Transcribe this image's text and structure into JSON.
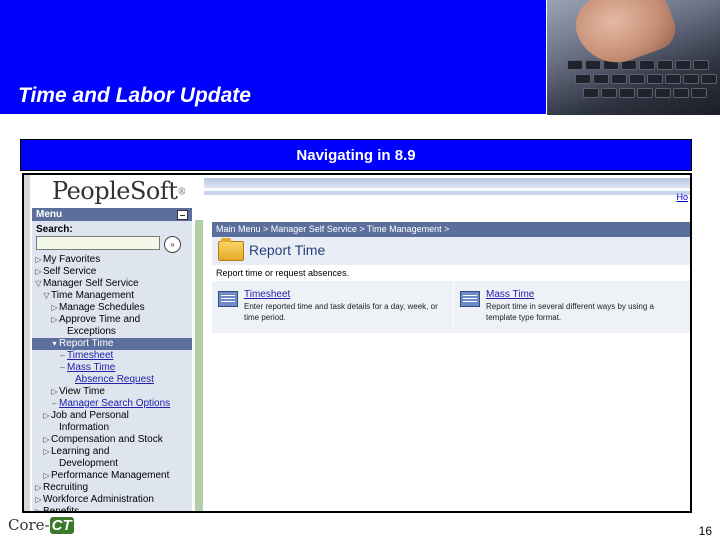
{
  "slide": {
    "title": "Time and Labor Update",
    "subtitle": "Navigating in 8.9",
    "page_number": "16",
    "footer_logo_prefix": "Core-",
    "footer_logo_mark": "CT"
  },
  "app": {
    "logo": "PeopleSoft",
    "logo_mark": "®",
    "home_link": "Ho",
    "menu": {
      "title": "Menu",
      "search_label": "Search:",
      "search_value": "",
      "go_glyph": "»",
      "items": [
        {
          "label": "My Favorites",
          "glyph": "▷",
          "level": 0
        },
        {
          "label": "Self Service",
          "glyph": "▷",
          "level": 0
        },
        {
          "label": "Manager Self Service",
          "glyph": "▽",
          "level": 0
        },
        {
          "label": "Time Management",
          "glyph": "▽",
          "level": 1
        },
        {
          "label": "Manage Schedules",
          "glyph": "▷",
          "level": 2
        },
        {
          "label": "Approve Time and",
          "glyph": "▷",
          "level": 2
        },
        {
          "label": "Exceptions",
          "glyph": "",
          "level": 3
        },
        {
          "label": "Report Time",
          "glyph": "▾",
          "level": 2,
          "selected": true
        },
        {
          "label": "Timesheet",
          "glyph": "–",
          "level": 3,
          "link": true
        },
        {
          "label": "Mass Time",
          "glyph": "–",
          "level": 3,
          "link": true
        },
        {
          "label": "Absence Request",
          "glyph": "",
          "level": 4,
          "link": true
        },
        {
          "label": "View Time",
          "glyph": "▷",
          "level": 2
        },
        {
          "label": "Manager Search Options",
          "glyph": "–",
          "level": 2,
          "link": true
        },
        {
          "label": "Job and Personal",
          "glyph": "▷",
          "level": 1
        },
        {
          "label": "Information",
          "glyph": "",
          "level": 2
        },
        {
          "label": "Compensation and Stock",
          "glyph": "▷",
          "level": 1
        },
        {
          "label": "Learning and",
          "glyph": "▷",
          "level": 1
        },
        {
          "label": "Development",
          "glyph": "",
          "level": 2
        },
        {
          "label": "Performance Management",
          "glyph": "▷",
          "level": 1
        },
        {
          "label": "Recruiting",
          "glyph": "▷",
          "level": 0
        },
        {
          "label": "Workforce Administration",
          "glyph": "▷",
          "level": 0
        },
        {
          "label": "Benefits",
          "glyph": "▷",
          "level": 0
        }
      ]
    },
    "breadcrumb": "Main Menu > Manager Self Service > Time Management >",
    "page_title": "Report Time",
    "page_subtitle": "Report time or request absences.",
    "tiles": [
      {
        "title": "Timesheet",
        "desc": "Enter reported time and task details for a day, week, or time period."
      },
      {
        "title": "Mass Time",
        "desc": "Report time in several different ways by using a template type format."
      }
    ]
  },
  "colors": {
    "banner_blue": "#0000ff",
    "menu_header": "#5c6f9c",
    "menu_bg": "#dfe5ef",
    "separator_green": "#b0cfa9"
  }
}
